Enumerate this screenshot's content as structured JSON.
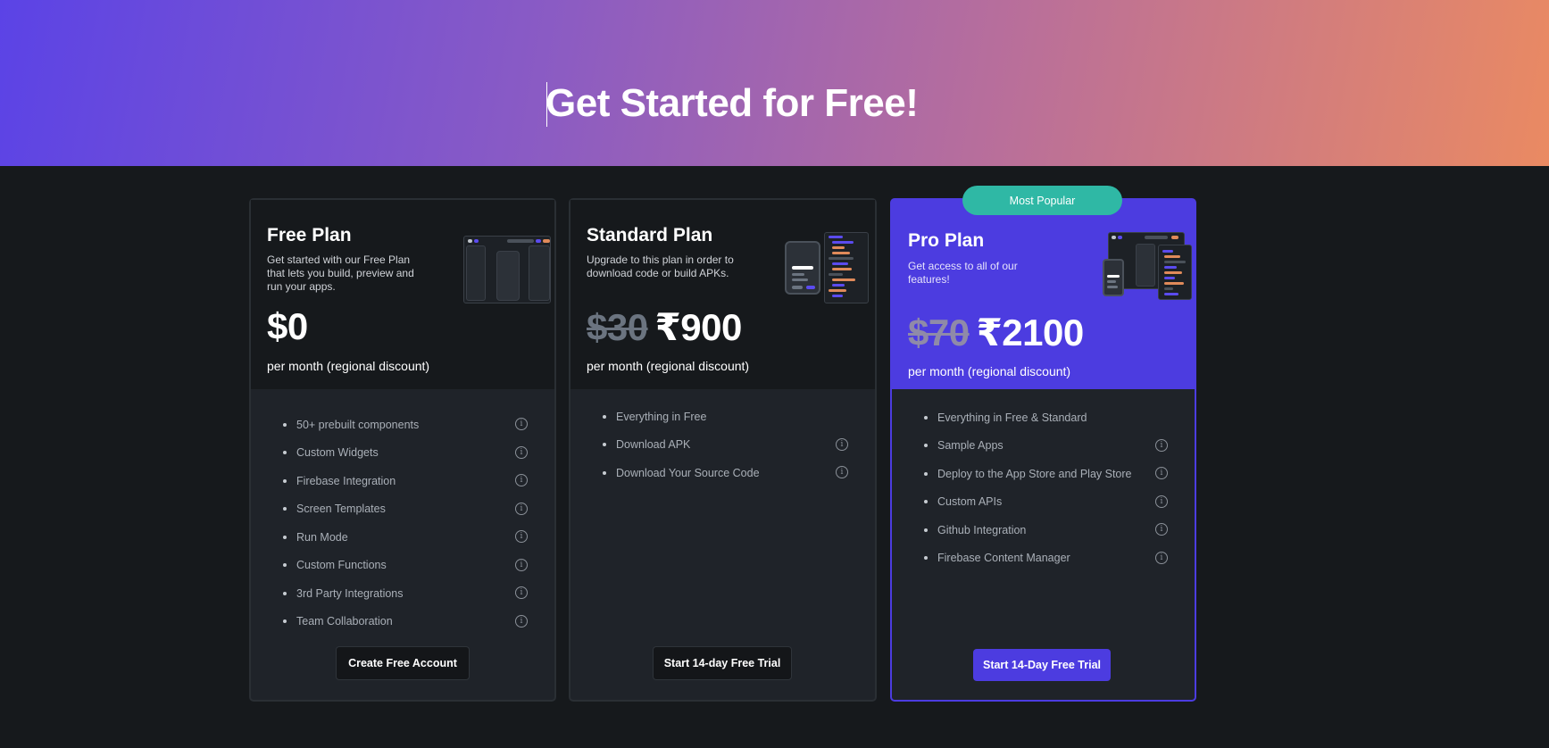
{
  "hero": {
    "title": "Get Started for Free!"
  },
  "plans": [
    {
      "title": "Free Plan",
      "description": "Get started with our Free Plan that lets you build, preview and run your apps.",
      "old_price": "",
      "price": "$0",
      "period": "per month (regional discount)",
      "features": [
        "50+ prebuilt components",
        "Custom Widgets",
        "Firebase Integration",
        "Screen Templates",
        "Run Mode",
        "Custom Functions",
        "3rd Party Integrations",
        "Team Collaboration"
      ],
      "button_label": "Create Free Account"
    },
    {
      "title": "Standard Plan",
      "description": "Upgrade to this plan in order to download code or build APKs.",
      "old_price": "$30",
      "price": "₹900",
      "period": "per month (regional discount)",
      "features": [
        "Everything in Free",
        "Download APK",
        "Download Your Source Code"
      ],
      "button_label": "Start 14-day Free Trial"
    },
    {
      "title": "Pro Plan",
      "badge": "Most Popular",
      "description": "Get access to all of our features!",
      "old_price": "$70",
      "price": "₹2100",
      "period": "per month (regional discount)",
      "features": [
        "Everything in Free & Standard",
        "Sample Apps",
        "Deploy to the App Store and Play Store",
        "Custom APIs",
        "Github Integration",
        "Firebase Content Manager"
      ],
      "button_label": "Start 14-Day Free Trial"
    }
  ],
  "icons": {
    "info": "info-circle-icon"
  },
  "colors": {
    "accent": "#4c3ce0",
    "badge": "#2fb8a5",
    "background": "#16191c"
  }
}
